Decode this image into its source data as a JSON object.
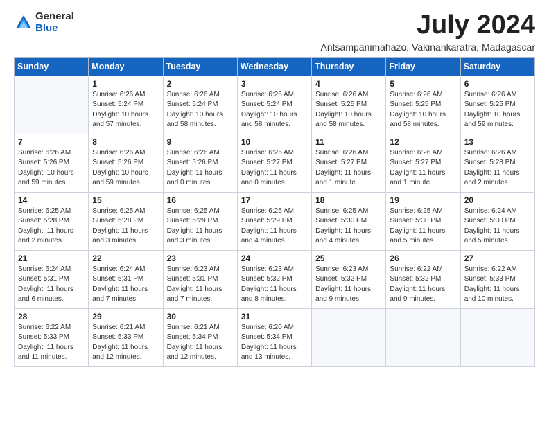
{
  "logo": {
    "general": "General",
    "blue": "Blue"
  },
  "title": "July 2024",
  "subtitle": "Antsampanimahazo, Vakinankaratra, Madagascar",
  "days_of_week": [
    "Sunday",
    "Monday",
    "Tuesday",
    "Wednesday",
    "Thursday",
    "Friday",
    "Saturday"
  ],
  "weeks": [
    [
      {
        "day": "",
        "info": ""
      },
      {
        "day": "1",
        "info": "Sunrise: 6:26 AM\nSunset: 5:24 PM\nDaylight: 10 hours\nand 57 minutes."
      },
      {
        "day": "2",
        "info": "Sunrise: 6:26 AM\nSunset: 5:24 PM\nDaylight: 10 hours\nand 58 minutes."
      },
      {
        "day": "3",
        "info": "Sunrise: 6:26 AM\nSunset: 5:24 PM\nDaylight: 10 hours\nand 58 minutes."
      },
      {
        "day": "4",
        "info": "Sunrise: 6:26 AM\nSunset: 5:25 PM\nDaylight: 10 hours\nand 58 minutes."
      },
      {
        "day": "5",
        "info": "Sunrise: 6:26 AM\nSunset: 5:25 PM\nDaylight: 10 hours\nand 58 minutes."
      },
      {
        "day": "6",
        "info": "Sunrise: 6:26 AM\nSunset: 5:25 PM\nDaylight: 10 hours\nand 59 minutes."
      }
    ],
    [
      {
        "day": "7",
        "info": "Sunrise: 6:26 AM\nSunset: 5:26 PM\nDaylight: 10 hours\nand 59 minutes."
      },
      {
        "day": "8",
        "info": "Sunrise: 6:26 AM\nSunset: 5:26 PM\nDaylight: 10 hours\nand 59 minutes."
      },
      {
        "day": "9",
        "info": "Sunrise: 6:26 AM\nSunset: 5:26 PM\nDaylight: 11 hours\nand 0 minutes."
      },
      {
        "day": "10",
        "info": "Sunrise: 6:26 AM\nSunset: 5:27 PM\nDaylight: 11 hours\nand 0 minutes."
      },
      {
        "day": "11",
        "info": "Sunrise: 6:26 AM\nSunset: 5:27 PM\nDaylight: 11 hours\nand 1 minute."
      },
      {
        "day": "12",
        "info": "Sunrise: 6:26 AM\nSunset: 5:27 PM\nDaylight: 11 hours\nand 1 minute."
      },
      {
        "day": "13",
        "info": "Sunrise: 6:26 AM\nSunset: 5:28 PM\nDaylight: 11 hours\nand 2 minutes."
      }
    ],
    [
      {
        "day": "14",
        "info": "Sunrise: 6:25 AM\nSunset: 5:28 PM\nDaylight: 11 hours\nand 2 minutes."
      },
      {
        "day": "15",
        "info": "Sunrise: 6:25 AM\nSunset: 5:28 PM\nDaylight: 11 hours\nand 3 minutes."
      },
      {
        "day": "16",
        "info": "Sunrise: 6:25 AM\nSunset: 5:29 PM\nDaylight: 11 hours\nand 3 minutes."
      },
      {
        "day": "17",
        "info": "Sunrise: 6:25 AM\nSunset: 5:29 PM\nDaylight: 11 hours\nand 4 minutes."
      },
      {
        "day": "18",
        "info": "Sunrise: 6:25 AM\nSunset: 5:30 PM\nDaylight: 11 hours\nand 4 minutes."
      },
      {
        "day": "19",
        "info": "Sunrise: 6:25 AM\nSunset: 5:30 PM\nDaylight: 11 hours\nand 5 minutes."
      },
      {
        "day": "20",
        "info": "Sunrise: 6:24 AM\nSunset: 5:30 PM\nDaylight: 11 hours\nand 5 minutes."
      }
    ],
    [
      {
        "day": "21",
        "info": "Sunrise: 6:24 AM\nSunset: 5:31 PM\nDaylight: 11 hours\nand 6 minutes."
      },
      {
        "day": "22",
        "info": "Sunrise: 6:24 AM\nSunset: 5:31 PM\nDaylight: 11 hours\nand 7 minutes."
      },
      {
        "day": "23",
        "info": "Sunrise: 6:23 AM\nSunset: 5:31 PM\nDaylight: 11 hours\nand 7 minutes."
      },
      {
        "day": "24",
        "info": "Sunrise: 6:23 AM\nSunset: 5:32 PM\nDaylight: 11 hours\nand 8 minutes."
      },
      {
        "day": "25",
        "info": "Sunrise: 6:23 AM\nSunset: 5:32 PM\nDaylight: 11 hours\nand 9 minutes."
      },
      {
        "day": "26",
        "info": "Sunrise: 6:22 AM\nSunset: 5:32 PM\nDaylight: 11 hours\nand 9 minutes."
      },
      {
        "day": "27",
        "info": "Sunrise: 6:22 AM\nSunset: 5:33 PM\nDaylight: 11 hours\nand 10 minutes."
      }
    ],
    [
      {
        "day": "28",
        "info": "Sunrise: 6:22 AM\nSunset: 5:33 PM\nDaylight: 11 hours\nand 11 minutes."
      },
      {
        "day": "29",
        "info": "Sunrise: 6:21 AM\nSunset: 5:33 PM\nDaylight: 11 hours\nand 12 minutes."
      },
      {
        "day": "30",
        "info": "Sunrise: 6:21 AM\nSunset: 5:34 PM\nDaylight: 11 hours\nand 12 minutes."
      },
      {
        "day": "31",
        "info": "Sunrise: 6:20 AM\nSunset: 5:34 PM\nDaylight: 11 hours\nand 13 minutes."
      },
      {
        "day": "",
        "info": ""
      },
      {
        "day": "",
        "info": ""
      },
      {
        "day": "",
        "info": ""
      }
    ]
  ]
}
